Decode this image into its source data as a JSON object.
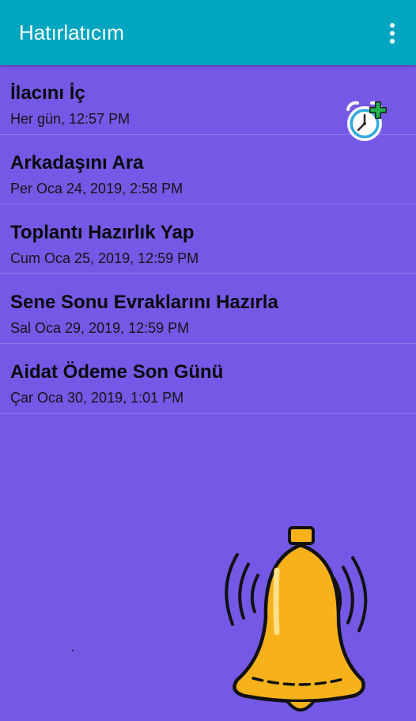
{
  "appbar": {
    "title": "Hatırlatıcım",
    "background": "#00A5BF",
    "menu_icon": "more-vert-icon"
  },
  "content": {
    "background": "#7459E6"
  },
  "reminders": [
    {
      "title": "İlacını İç",
      "subtitle": "Her gün, 12:57 PM"
    },
    {
      "title": "Arkadaşını Ara",
      "subtitle": "Per Oca 24, 2019, 2:58 PM"
    },
    {
      "title": "Toplantı Hazırlık Yap",
      "subtitle": "Cum Oca 25, 2019, 12:59 PM"
    },
    {
      "title": "Sene Sonu Evraklarını Hazırla",
      "subtitle": "Sal Oca 29, 2019, 12:59 PM"
    },
    {
      "title": "Aidat Ödeme Son Günü",
      "subtitle": "Çar Oca 30, 2019, 1:01 PM"
    }
  ],
  "icons": {
    "add_alarm": "add-alarm-icon",
    "bell": "ringing-bell-icon"
  }
}
